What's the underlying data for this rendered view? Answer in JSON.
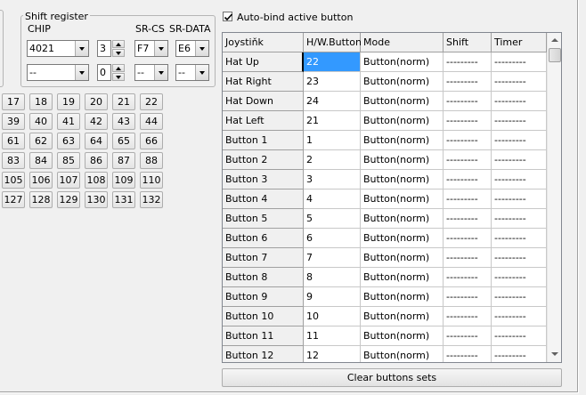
{
  "shift_register": {
    "title": "Shift register",
    "labels": {
      "chip": "CHIP",
      "sr_cs": "SR-CS",
      "sr_data": "SR-DATA"
    },
    "rows": [
      {
        "chip": "4021",
        "count": "3",
        "sr_cs": "F7",
        "sr_data": "E6"
      },
      {
        "chip": "--",
        "count": "0",
        "sr_cs": "--",
        "sr_data": "--"
      }
    ]
  },
  "number_buttons": [
    [
      "17",
      "18",
      "19",
      "20",
      "21",
      "22"
    ],
    [
      "39",
      "40",
      "41",
      "42",
      "43",
      "44"
    ],
    [
      "61",
      "62",
      "63",
      "64",
      "65",
      "66"
    ],
    [
      "83",
      "84",
      "85",
      "86",
      "87",
      "88"
    ],
    [
      "105",
      "106",
      "107",
      "108",
      "109",
      "110"
    ],
    [
      "127",
      "128",
      "129",
      "130",
      "131",
      "132"
    ]
  ],
  "auto_bind": {
    "label": "Auto-bind active button",
    "checked": true
  },
  "grid": {
    "headers": [
      "Joystiňk",
      "H/W.Button",
      "Mode",
      "Shift",
      "Timer"
    ],
    "selected_row": 0,
    "rows": [
      {
        "name": "Hat Up",
        "hw": "22",
        "mode": "Button(norm)",
        "shift": "---------",
        "timer": "---------"
      },
      {
        "name": "Hat Right",
        "hw": "23",
        "mode": "Button(norm)",
        "shift": "---------",
        "timer": "---------"
      },
      {
        "name": "Hat Down",
        "hw": "24",
        "mode": "Button(norm)",
        "shift": "---------",
        "timer": "---------"
      },
      {
        "name": "Hat Left",
        "hw": "21",
        "mode": "Button(norm)",
        "shift": "---------",
        "timer": "---------"
      },
      {
        "name": "Button 1",
        "hw": "1",
        "mode": "Button(norm)",
        "shift": "---------",
        "timer": "---------"
      },
      {
        "name": "Button 2",
        "hw": "2",
        "mode": "Button(norm)",
        "shift": "---------",
        "timer": "---------"
      },
      {
        "name": "Button 3",
        "hw": "3",
        "mode": "Button(norm)",
        "shift": "---------",
        "timer": "---------"
      },
      {
        "name": "Button 4",
        "hw": "4",
        "mode": "Button(norm)",
        "shift": "---------",
        "timer": "---------"
      },
      {
        "name": "Button 5",
        "hw": "5",
        "mode": "Button(norm)",
        "shift": "---------",
        "timer": "---------"
      },
      {
        "name": "Button 6",
        "hw": "6",
        "mode": "Button(norm)",
        "shift": "---------",
        "timer": "---------"
      },
      {
        "name": "Button 7",
        "hw": "7",
        "mode": "Button(norm)",
        "shift": "---------",
        "timer": "---------"
      },
      {
        "name": "Button 8",
        "hw": "8",
        "mode": "Button(norm)",
        "shift": "---------",
        "timer": "---------"
      },
      {
        "name": "Button 9",
        "hw": "9",
        "mode": "Button(norm)",
        "shift": "---------",
        "timer": "---------"
      },
      {
        "name": "Button 10",
        "hw": "10",
        "mode": "Button(norm)",
        "shift": "---------",
        "timer": "---------"
      },
      {
        "name": "Button 11",
        "hw": "11",
        "mode": "Button(norm)",
        "shift": "---------",
        "timer": "---------"
      },
      {
        "name": "Button 12",
        "hw": "12",
        "mode": "Button(norm)",
        "shift": "---------",
        "timer": "---------"
      }
    ]
  },
  "clear_button": {
    "label": "Clear buttons sets"
  },
  "colors": {
    "selection": "#3399ff",
    "face": "#f0f0f0",
    "grid_line": "#c8c8c8"
  },
  "icons": {
    "checkbox": "checkmark-icon",
    "combo": "chevron-down-icon",
    "spin_up": "caret-up-icon",
    "spin_down": "caret-down-icon"
  }
}
